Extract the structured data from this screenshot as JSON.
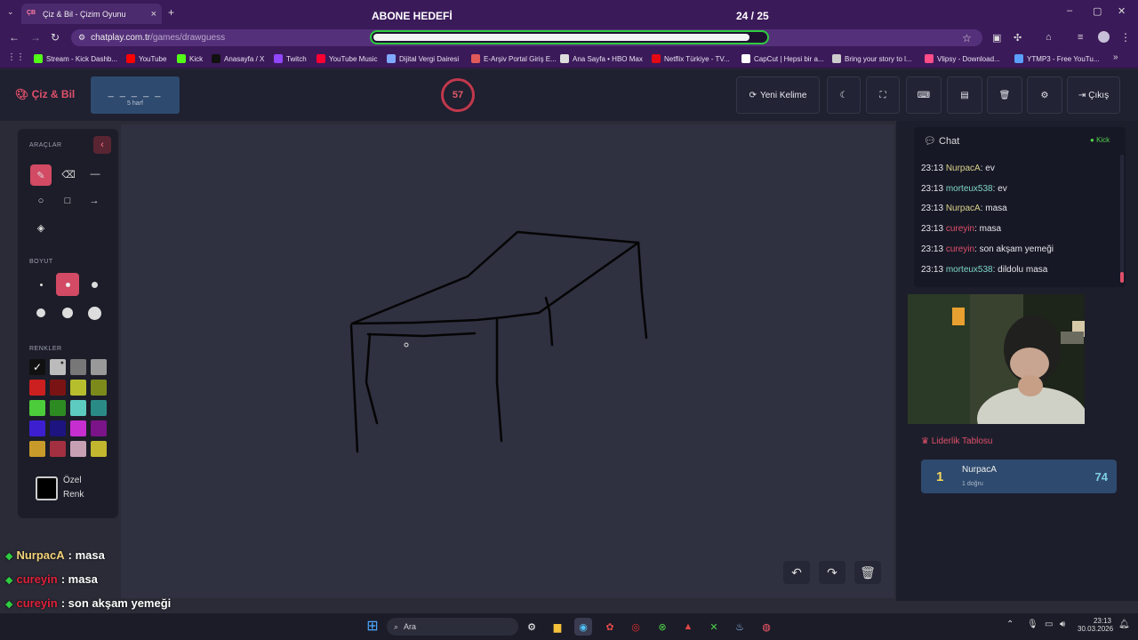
{
  "browser": {
    "tab_title": "Çiz & Bil - Çizim Oyunu",
    "tab_favicon": "ÇB",
    "url_host": "chatplay.com.tr",
    "url_path": "/games/drawguess",
    "bookmarks": [
      {
        "label": "Stream - Kick Dashb...",
        "icon": "kick-icon",
        "color": "#53fc18"
      },
      {
        "label": "YouTube",
        "icon": "youtube-icon",
        "color": "#ff0000"
      },
      {
        "label": "Kick",
        "icon": "kick-icon",
        "color": "#53fc18"
      },
      {
        "label": "Anasayfa / X",
        "icon": "x-icon",
        "color": "#111111"
      },
      {
        "label": "Twitch",
        "icon": "twitch-icon",
        "color": "#9146ff"
      },
      {
        "label": "YouTube Music",
        "icon": "youtube-music-icon",
        "color": "#ff0033"
      },
      {
        "label": "Dijital Vergi Dairesi",
        "icon": "gov-icon",
        "color": "#7fa8ff"
      },
      {
        "label": "E-Arşiv Portal Giriş E...",
        "icon": "doc-icon",
        "color": "#e05a5a"
      },
      {
        "label": "Ana Sayfa • HBO Max",
        "icon": "hbo-icon",
        "color": "#dddddd"
      },
      {
        "label": "Netflix Türkiye - TV...",
        "icon": "netflix-icon",
        "color": "#e50914"
      },
      {
        "label": "CapCut | Hepsi bir a...",
        "icon": "capcut-icon",
        "color": "#ffffff"
      },
      {
        "label": "Bring your story to l...",
        "icon": "canva-icon",
        "color": "#cccccc"
      },
      {
        "label": "Vlipsy - Download...",
        "icon": "vlipsy-icon",
        "color": "#ff4d88"
      },
      {
        "label": "YTMP3 - Free YouTu...",
        "icon": "ytmp3-icon",
        "color": "#5aa0ff"
      }
    ]
  },
  "stream_goal": {
    "title": "ABONE HEDEFİ",
    "count": "24 / 25",
    "progress": 0.96
  },
  "game": {
    "logo": "Çiz & Bil",
    "word_mask": "_ _ _ _ _",
    "word_hint": "5 harf",
    "timer": "57",
    "new_word_label": "Yeni Kelime",
    "exit_label": "Çıkış"
  },
  "tools": {
    "tools_heading": "ARAÇLAR",
    "size_heading": "BOYUT",
    "colors_heading": "RENKLER",
    "custom_color_label_1": "Özel",
    "custom_color_label_2": "Renk",
    "palette": [
      "#111111",
      "#bbbbbb",
      "#777777",
      "#999999",
      "#cc1f1f",
      "#7a1414",
      "#b7be2e",
      "#7c8a1c",
      "#4ccc3a",
      "#2d8a22",
      "#5ecbc0",
      "#2a8b86",
      "#3d1fd0",
      "#1d1480",
      "#c62ed0",
      "#7a1488",
      "#c89a2a",
      "#a33040",
      "#c8a0b4",
      "#c2b62e"
    ]
  },
  "chat": {
    "title": "Chat",
    "platform": "Kick",
    "messages": [
      {
        "time": "23:13",
        "user": "NurpacA",
        "color": "#d9d38a",
        "text": ": ev"
      },
      {
        "time": "23:13",
        "user": "morteux538",
        "color": "#7fd8c8",
        "text": ": ev"
      },
      {
        "time": "23:13",
        "user": "NurpacA",
        "color": "#d9d38a",
        "text": ": masa"
      },
      {
        "time": "23:13",
        "user": "cureyin",
        "color": "#e0506a",
        "text": ": masa"
      },
      {
        "time": "23:13",
        "user": "cureyin",
        "color": "#e0506a",
        "text": ": son akşam yemeği"
      },
      {
        "time": "23:13",
        "user": "morteux538",
        "color": "#7fd8c8",
        "text": ": dildolu masa"
      }
    ]
  },
  "leaderboard": {
    "title": "Liderlik Tablosu",
    "rows": [
      {
        "rank": "1",
        "name": "NurpacA",
        "sub": "1 doğru",
        "score": "74"
      }
    ]
  },
  "overlay_chat": [
    {
      "user": "NurpacA",
      "color": "#f2d27a",
      "text": ": masa"
    },
    {
      "user": "cureyin",
      "color": "#e0203c",
      "text": ": masa"
    },
    {
      "user": "cureyin",
      "color": "#e0203c",
      "text": ": son akşam yemeği"
    },
    {
      "user": "morteux538",
      "color": "#8ad0f0",
      "text": ": dildolu masa"
    }
  ],
  "taskbar": {
    "search_placeholder": "Ara",
    "time": "23:13",
    "date": "30.03.2026"
  }
}
